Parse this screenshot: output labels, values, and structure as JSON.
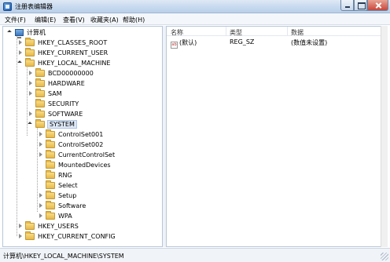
{
  "window": {
    "title": "注册表编辑器",
    "icon": "registry-editor-icon"
  },
  "menu": [
    "文件(F)",
    "编辑(E)",
    "查看(V)",
    "收藏夹(A)",
    "帮助(H)"
  ],
  "tree": [
    {
      "label": "计算机",
      "icon": "computer-icon",
      "expander": "open"
    },
    {
      "label": "HKEY_CLASSES_ROOT",
      "icon": "folder-icon",
      "expander": "closed"
    },
    {
      "label": "HKEY_CURRENT_USER",
      "icon": "folder-icon",
      "expander": "closed"
    },
    {
      "label": "HKEY_LOCAL_MACHINE",
      "icon": "folder-icon",
      "expander": "open"
    },
    {
      "label": "BCD00000000",
      "icon": "folder-icon",
      "expander": "closed"
    },
    {
      "label": "HARDWARE",
      "icon": "folder-icon",
      "expander": "closed"
    },
    {
      "label": "SAM",
      "icon": "folder-icon",
      "expander": "closed"
    },
    {
      "label": "SECURITY",
      "icon": "folder-icon",
      "expander": "none"
    },
    {
      "label": "SOFTWARE",
      "icon": "folder-icon",
      "expander": "closed"
    },
    {
      "label": "SYSTEM",
      "icon": "folder-icon",
      "expander": "open",
      "selected": true
    },
    {
      "label": "ControlSet001",
      "icon": "folder-icon",
      "expander": "closed"
    },
    {
      "label": "ControlSet002",
      "icon": "folder-icon",
      "expander": "closed"
    },
    {
      "label": "CurrentControlSet",
      "icon": "folder-icon",
      "expander": "closed"
    },
    {
      "label": "MountedDevices",
      "icon": "folder-icon",
      "expander": "none"
    },
    {
      "label": "RNG",
      "icon": "folder-icon",
      "expander": "none"
    },
    {
      "label": "Select",
      "icon": "folder-icon",
      "expander": "none"
    },
    {
      "label": "Setup",
      "icon": "folder-icon",
      "expander": "closed"
    },
    {
      "label": "Software",
      "icon": "folder-icon",
      "expander": "closed"
    },
    {
      "label": "WPA",
      "icon": "folder-icon",
      "expander": "closed"
    },
    {
      "label": "HKEY_USERS",
      "icon": "folder-icon",
      "expander": "closed"
    },
    {
      "label": "HKEY_CURRENT_CONFIG",
      "icon": "folder-icon",
      "expander": "closed"
    }
  ],
  "list": {
    "columns": [
      "名称",
      "类型",
      "数据"
    ],
    "rows": [
      {
        "icon": "string-value-icon",
        "icon_text": "ab",
        "name": "(默认)",
        "type": "REG_SZ",
        "data": "(数值未设置)"
      }
    ]
  },
  "status": {
    "path": "计算机\\HKEY_LOCAL_MACHINE\\SYSTEM"
  }
}
